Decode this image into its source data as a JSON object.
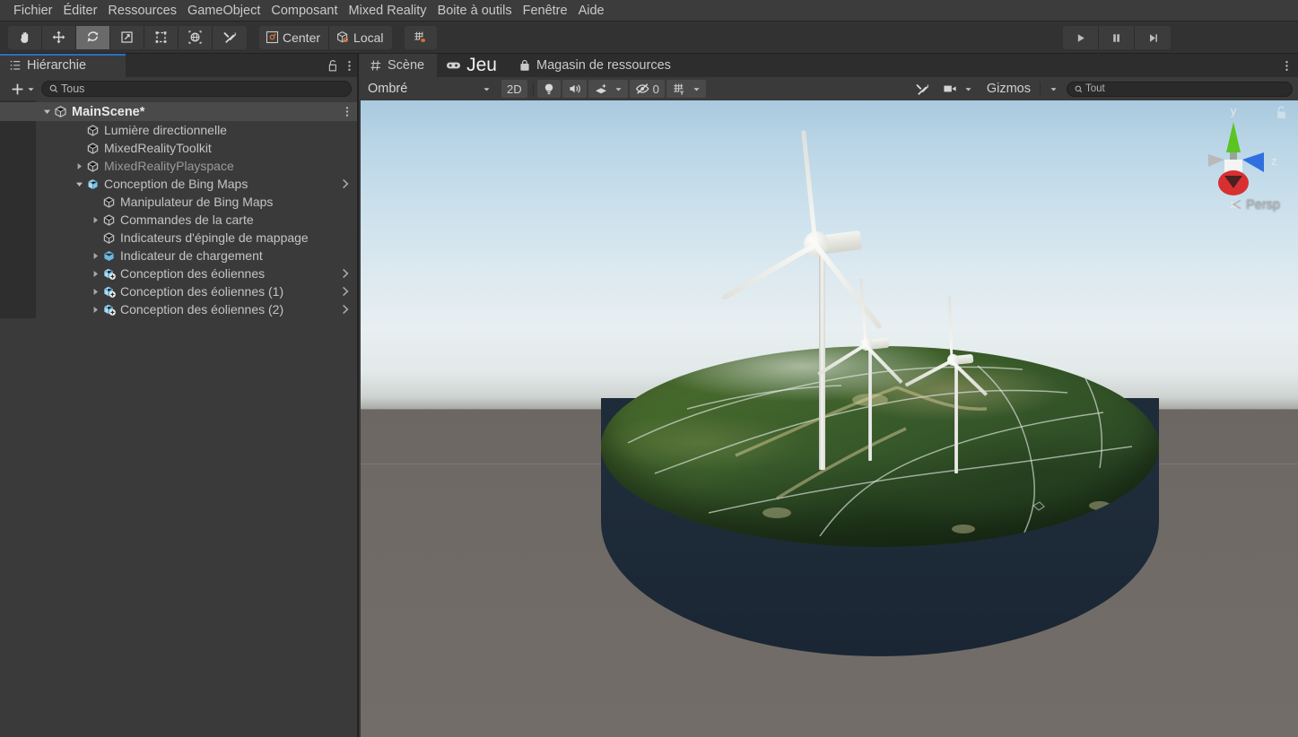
{
  "menubar": {
    "items": [
      {
        "label": "Fichier"
      },
      {
        "label": "Éditer"
      },
      {
        "label": "Ressources"
      },
      {
        "label": "GameObject"
      },
      {
        "label": "Composant"
      },
      {
        "label": "Mixed Reality"
      },
      {
        "label": "Boite à outils"
      },
      {
        "label": "Fenêtre"
      },
      {
        "label": "Aide"
      }
    ]
  },
  "toolbar": {
    "tools": [
      {
        "name": "hand-tool",
        "active": false
      },
      {
        "name": "move-tool",
        "active": false
      },
      {
        "name": "rotate-tool",
        "active": true
      },
      {
        "name": "scale-tool",
        "active": false
      },
      {
        "name": "rect-tool",
        "active": false
      },
      {
        "name": "transform-tool",
        "active": false
      },
      {
        "name": "custom-editor-tool",
        "active": false
      }
    ],
    "pivot_label": "Center",
    "handle_label": "Local",
    "snap_name": "grid-snap-icon",
    "play_label": "Lecture",
    "pause_label": "Pause",
    "step_label": "Étape"
  },
  "hierarchy": {
    "tab_label": "Hiérarchie",
    "search_placeholder": "Tous",
    "search_value": "Tous",
    "rows": [
      {
        "label": "MainScene*",
        "depth": 0,
        "icon": "scene-icon",
        "arrow": "down",
        "type": "scene"
      },
      {
        "label": "Lumière directionnelle",
        "depth": 2,
        "icon": "gameobject-icon",
        "arrow": "none",
        "type": "gameobject"
      },
      {
        "label": "MixedRealityToolkit",
        "depth": 2,
        "icon": "gameobject-icon",
        "arrow": "none",
        "type": "gameobject"
      },
      {
        "label": "MixedRealityPlayspace",
        "depth": 2,
        "icon": "gameobject-icon",
        "arrow": "right",
        "type": "gameobject-dim"
      },
      {
        "label": "Conception de Bing Maps",
        "depth": 2,
        "icon": "prefab-icon",
        "arrow": "down",
        "type": "prefab",
        "chevron": true
      },
      {
        "label": "Manipulateur de Bing Maps",
        "depth": 3,
        "icon": "gameobject-icon",
        "arrow": "none",
        "type": "gameobject"
      },
      {
        "label": "Commandes de la carte",
        "depth": 3,
        "icon": "gameobject-icon",
        "arrow": "right",
        "type": "gameobject"
      },
      {
        "label": "Indicateurs d'épingle de mappage",
        "depth": 3,
        "icon": "gameobject-icon",
        "arrow": "none",
        "type": "gameobject"
      },
      {
        "label": "Indicateur de chargement",
        "depth": 3,
        "icon": "prefab-filled-icon",
        "arrow": "right",
        "type": "prefab"
      },
      {
        "label": "Conception des éoliennes",
        "depth": 3,
        "icon": "prefab-variant-icon",
        "arrow": "right",
        "type": "prefab-variant",
        "chevron": true
      },
      {
        "label": "Conception des éoliennes (1)",
        "depth": 3,
        "icon": "prefab-variant-icon",
        "arrow": "right",
        "type": "prefab-variant",
        "chevron": true
      },
      {
        "label": "Conception des éoliennes (2)",
        "depth": 3,
        "icon": "prefab-variant-icon",
        "arrow": "right",
        "type": "prefab-variant",
        "chevron": true
      }
    ]
  },
  "scene_panel": {
    "tabs": [
      {
        "label": "Scène",
        "icon": "scene-grid-icon",
        "active": true,
        "big": false
      },
      {
        "label": "Jeu",
        "icon": "gamepad-icon",
        "active": false,
        "big": true
      },
      {
        "label": "Magasin de ressources",
        "icon": "store-icon",
        "active": false,
        "big": false
      }
    ],
    "toolbar": {
      "shading_mode": "Ombré",
      "mode_2d": "2D",
      "lighting_icon": "lightbulb-icon",
      "audio_icon": "speaker-icon",
      "fx_icon": "effects-icon",
      "hidden_count": "0",
      "hidden_icon": "hidden-eye-icon",
      "grid_icon": "grid-axis-icon",
      "tools_icon": "scene-tools-icon",
      "camera_icon": "scene-camera-icon",
      "gizmos_label": "Gizmos",
      "search_placeholder": "Tout",
      "search_value": "Tout"
    },
    "viewport": {
      "projection_label": "Persp",
      "gizmo_axes": [
        {
          "axis": "y",
          "color": "#5ac420"
        },
        {
          "axis": "z",
          "color": "#2f6fe0"
        },
        {
          "axis": "x",
          "color": "#d83030"
        }
      ],
      "sky_top_color": "#a9c9de",
      "sky_horizon_color": "#e8eff1",
      "ground_color": "#6e6865",
      "terrain_color": "#3d6129",
      "terrain_side_color": "#1e2b39",
      "turbine_color": "#f2f2ee",
      "turbine_count": 3
    }
  }
}
